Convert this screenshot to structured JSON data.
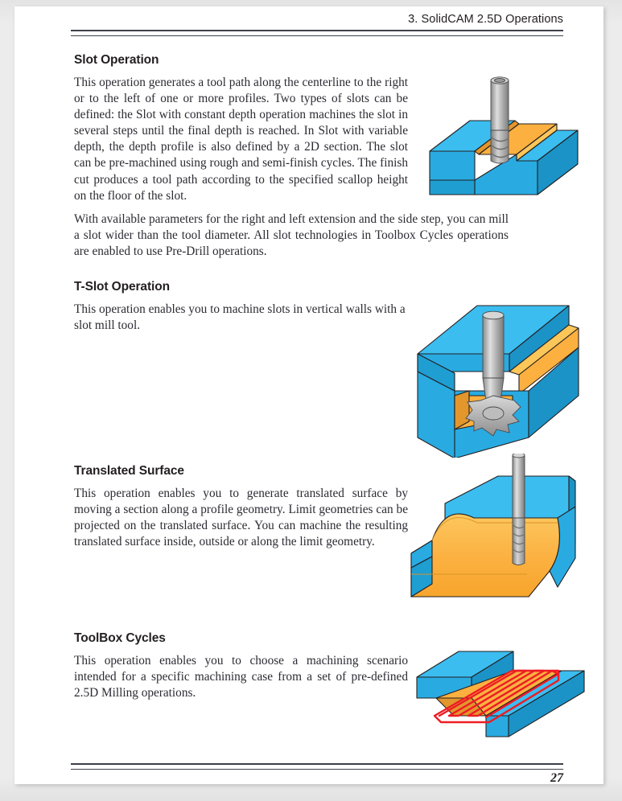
{
  "document": {
    "header_title": "3. SolidCAM 2.5D Operations",
    "page_number": "27"
  },
  "colors": {
    "stock_cyan": "#29abe2",
    "stock_cyan_top": "#3bbdf0",
    "stock_cyan_dark": "#1b93c7",
    "machined_orange": "#fbb040",
    "machined_orange_light": "#fcc659",
    "machined_orange_dark": "#e2962c",
    "tool_gray_light": "#d9d9d9",
    "tool_gray": "#9c9c9c",
    "tool_gray_dark": "#6e6e6e",
    "toolpath_red": "#ed1c24",
    "outline": "#231f20",
    "text": "#2b2b33",
    "rule": "#3c4049"
  },
  "sections": [
    {
      "id": "slot",
      "heading": "Slot Operation",
      "paragraphs": [
        "This operation generates a tool path along the centerline to the right or to the left of one or more profiles. Two types of slots can be defined: the Slot with constant depth operation machines the slot in several steps until the final depth is reached. In Slot with variable depth, the depth profile is also defined by a 2D section. The slot can be pre-machined using rough and semi-finish cycles. The finish cut produces a tool path according to the specified scallop height on the floor of the slot.",
        "With available parameters for the right and left extension and the side step, you can mill a slot wider than the tool diameter. All slot technologies in Toolbox Cycles operations are enabled to use Pre-Drill operations."
      ],
      "figure": "slot-operation-illustration"
    },
    {
      "id": "tslot",
      "heading": "T-Slot Operation",
      "paragraphs": [
        "This operation enables you to machine slots in vertical walls with a slot mill tool."
      ],
      "figure": "t-slot-operation-illustration"
    },
    {
      "id": "translated",
      "heading": "Translated Surface",
      "paragraphs": [
        "This operation enables you to generate translated surface by moving a section along a profile geometry. Limit geometries can be projected on the translated surface. You can machine the resulting translated surface inside, outside or along the limit geometry."
      ],
      "figure": "translated-surface-illustration"
    },
    {
      "id": "toolbox",
      "heading": "ToolBox Cycles",
      "paragraphs": [
        "This operation enables you to choose a machining scenario intended for a specific machining case from a set of pre-defined 2.5D Milling operations."
      ],
      "figure": "toolbox-cycles-illustration"
    }
  ]
}
